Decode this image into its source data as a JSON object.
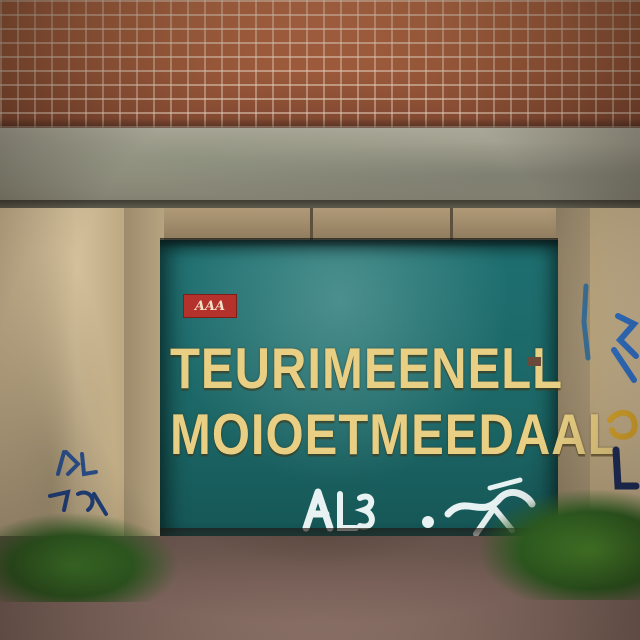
{
  "sign": {
    "sticker_text": "AAA",
    "line1": "TEURIMEENELL",
    "line2": "MOIOETMEEDAAL"
  },
  "colors": {
    "door_teal": "#1f6f70",
    "lettering": "#e8cf84",
    "sticker_red": "#b4322b",
    "brick": "#9a5a3c",
    "concrete": "#a9a797"
  }
}
